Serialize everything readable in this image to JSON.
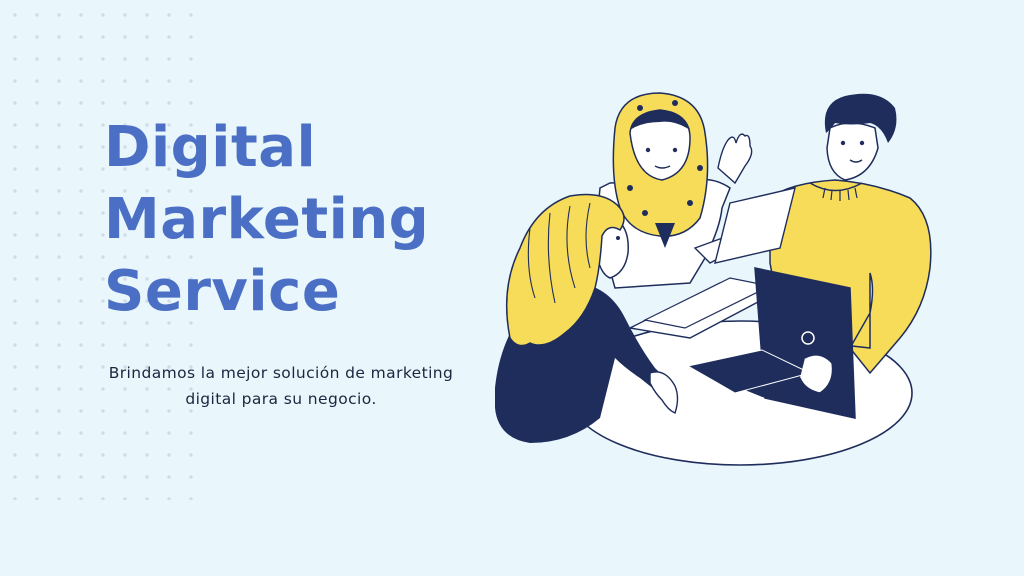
{
  "slide": {
    "title_lines": [
      "Digital",
      "Marketing",
      "Service"
    ],
    "subtitle": "Brindamos la mejor solución de marketing digital para su negocio.",
    "colors": {
      "background": "#e9f6fb",
      "title": "#4a6fc4",
      "subtitle": "#1e2540",
      "navy": "#1f2d5c",
      "yellow": "#f7dc5a",
      "dot": "#cfdbe8"
    }
  },
  "illustration": {
    "icons": [
      "meeting-illustration",
      "woman-hijab",
      "man-yellow-sweater",
      "woman-blonde-hair",
      "laptop",
      "paper-documents",
      "round-table"
    ]
  }
}
